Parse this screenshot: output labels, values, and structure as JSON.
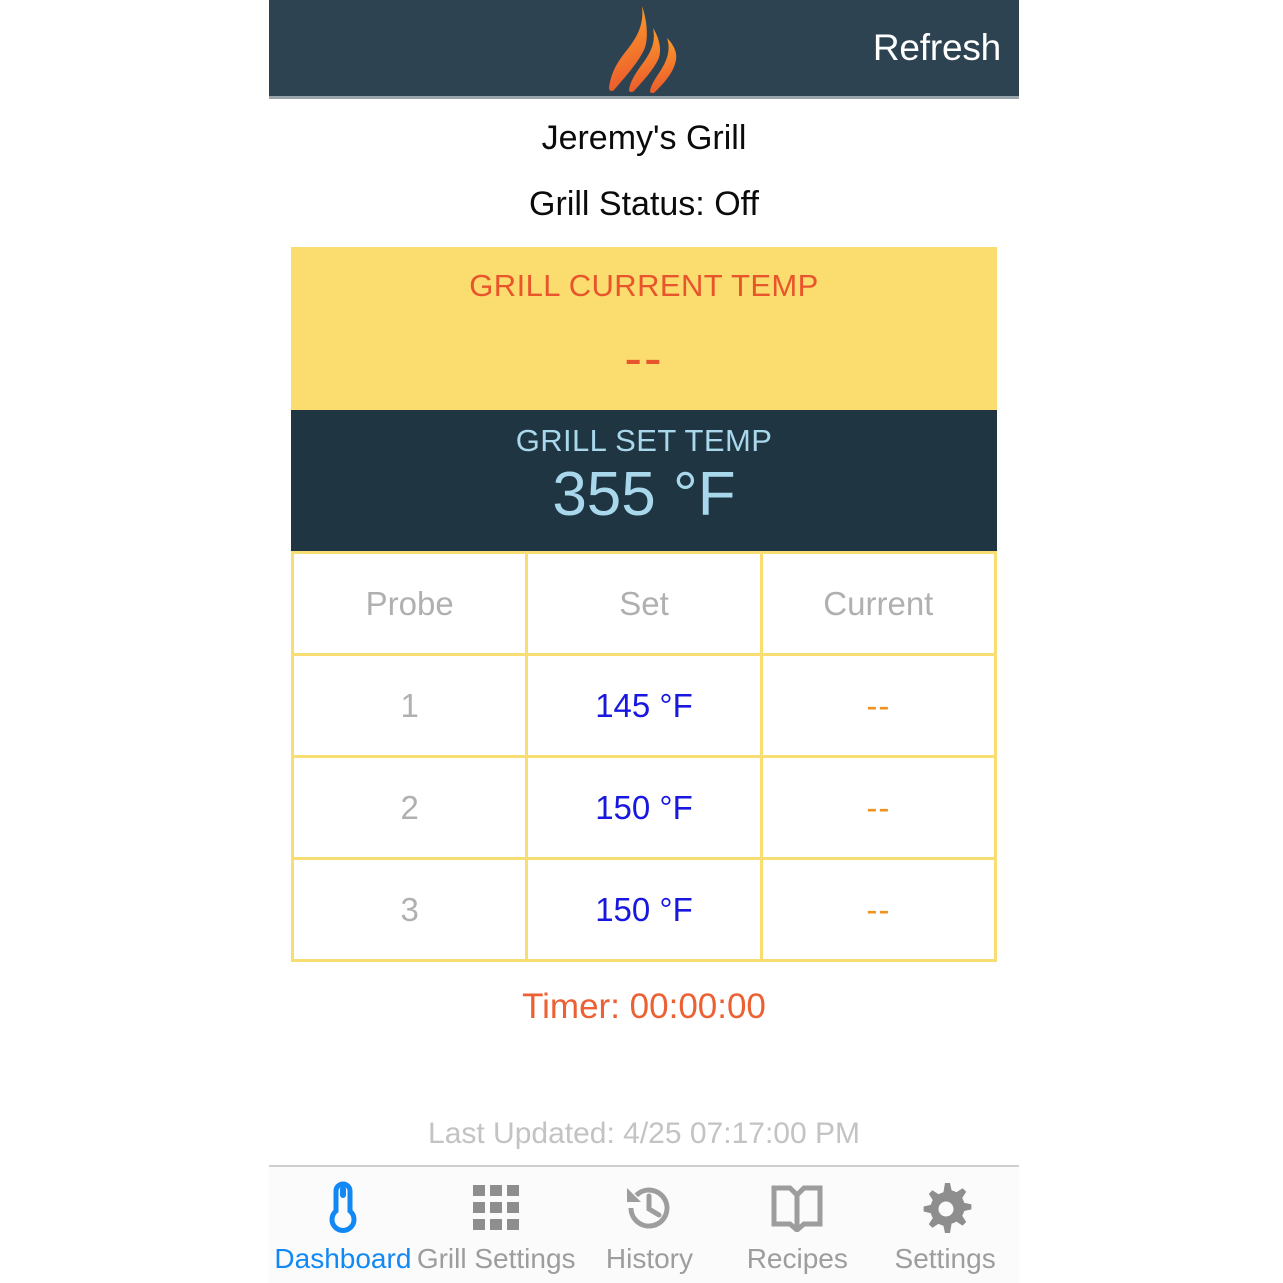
{
  "header": {
    "logo_icon": "flame-logo-icon",
    "refresh_label": "Refresh",
    "background_color": "#2d4351",
    "text_color": "#ffffff"
  },
  "device": {
    "name": "Jeremy's Grill",
    "status_line": "Grill Status: Off"
  },
  "current_temp": {
    "label": "GRILL CURRENT TEMP",
    "value": "--",
    "background_color": "#fadd6e",
    "text_color": "#e8552c"
  },
  "set_temp": {
    "label": "GRILL SET TEMP",
    "value": "355 °F",
    "background_color": "#1f3642",
    "text_color": "#a9d8ec"
  },
  "probe_table": {
    "columns": [
      "Probe",
      "Set",
      "Current"
    ],
    "border_color": "#f8dd72",
    "rows": [
      {
        "probe": "1",
        "set": "145 °F",
        "current": "--"
      },
      {
        "probe": "2",
        "set": "150 °F",
        "current": "--"
      },
      {
        "probe": "3",
        "set": "150 °F",
        "current": "--"
      }
    ]
  },
  "timer": {
    "text": "Timer: 00:00:00",
    "color": "#ec6133"
  },
  "last_updated": {
    "text": "Last Updated: 4/25 07:17:00 PM",
    "color": "#c3c3c3"
  },
  "tabbar": {
    "active_color": "#1288f4",
    "inactive_color": "#9d9d9d",
    "tabs": [
      {
        "label": "Dashboard",
        "icon": "thermometer-icon",
        "active": true
      },
      {
        "label": "Grill Settings",
        "icon": "grid-icon",
        "active": false
      },
      {
        "label": "History",
        "icon": "clock-rewind-icon",
        "active": false
      },
      {
        "label": "Recipes",
        "icon": "open-book-icon",
        "active": false
      },
      {
        "label": "Settings",
        "icon": "gear-icon",
        "active": false
      }
    ]
  }
}
